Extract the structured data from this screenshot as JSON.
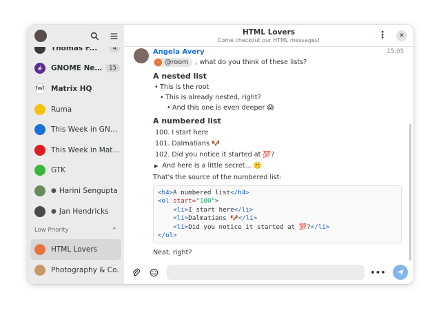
{
  "sidebar": {
    "header": {
      "search_icon": "search-icon",
      "menu_icon": "hamburger-menu-icon"
    },
    "rooms": [
      {
        "name": "Thomas F...",
        "badge": "4",
        "kind": "person",
        "avatar_color": "#3a3a3a",
        "bold": true
      },
      {
        "name": "GNOME New...",
        "badge": "15",
        "kind": "room",
        "avatar_color": "#5c2d91",
        "avatar_glyph": "é",
        "bold": true
      },
      {
        "name": "Matrix HQ",
        "badge": "",
        "kind": "room",
        "avatar_color": "#ffffff",
        "avatar_glyph": "[m]",
        "bold": true
      },
      {
        "name": "Ruma",
        "badge": "",
        "kind": "room",
        "avatar_color": "#f5c211",
        "bold": false
      },
      {
        "name": "This Week in GNOME",
        "badge": "",
        "kind": "room",
        "avatar_color": "#1c71d8",
        "bold": false
      },
      {
        "name": "This Week in Matri...",
        "badge": "",
        "kind": "room",
        "avatar_color": "#e01b24",
        "bold": false
      },
      {
        "name": "GTK",
        "badge": "",
        "kind": "room",
        "avatar_color": "#3ab53a",
        "bold": false
      },
      {
        "name": "Harini Sengupta",
        "badge": "",
        "kind": "person",
        "avatar_color": "#6a8a5a",
        "bold": false
      },
      {
        "name": "Jan Hendricks",
        "badge": "",
        "kind": "person",
        "avatar_color": "#4a4a4a",
        "bold": false
      }
    ],
    "section_low_priority": "Low Priority",
    "low_priority_rooms": [
      {
        "name": "HTML Lovers",
        "kind": "room",
        "avatar_color": "#e8743b",
        "selected": true
      },
      {
        "name": "Photography & Co.",
        "kind": "room",
        "avatar_color": "#c89a6a",
        "selected": false
      }
    ]
  },
  "header": {
    "title": "HTML Lovers",
    "topic": "Come checkout our HTML messages!"
  },
  "message": {
    "sender": "Angela Avery",
    "time": "15:05",
    "mention": "@room",
    "intro_text": ", what do you think of these lists?",
    "nested_heading": "A nested list",
    "nested": [
      "This is the root",
      "This is already nested, right?",
      "And this one is even deeper 😱"
    ],
    "numbered_heading": "A numbered list",
    "numbered": [
      "100.  I start here",
      "101.  Dalmatians 🐶",
      "102.  Did you notice it started at 💯?"
    ],
    "details_summary": "And here is a little secret... 🤫",
    "source_caption": "That's the source of the numbered list:",
    "code_lines": [
      {
        "tag_open": "<h4>",
        "text": "A numbered list",
        "tag_close": "</h4>"
      },
      {
        "tag_open": "<ol ",
        "attr": "start=",
        "str": "\"100\"",
        "tag_close": ">"
      },
      {
        "indent": "    ",
        "tag_open": "<li>",
        "text": "I start here",
        "tag_close": "</li>"
      },
      {
        "indent": "    ",
        "tag_open": "<li>",
        "text": "Dalmatians 🐶",
        "tag_close": "</li>"
      },
      {
        "indent": "    ",
        "tag_open": "<li>",
        "text": "Did you notice it started at 💯?",
        "tag_close": "</li>"
      },
      {
        "tag_close": "</ol>"
      }
    ],
    "closing": "Neat, right?"
  },
  "composer": {
    "attach_icon": "paperclip-icon",
    "emoji_icon": "emoji-icon",
    "more": "•••",
    "send_icon": "send-icon"
  }
}
